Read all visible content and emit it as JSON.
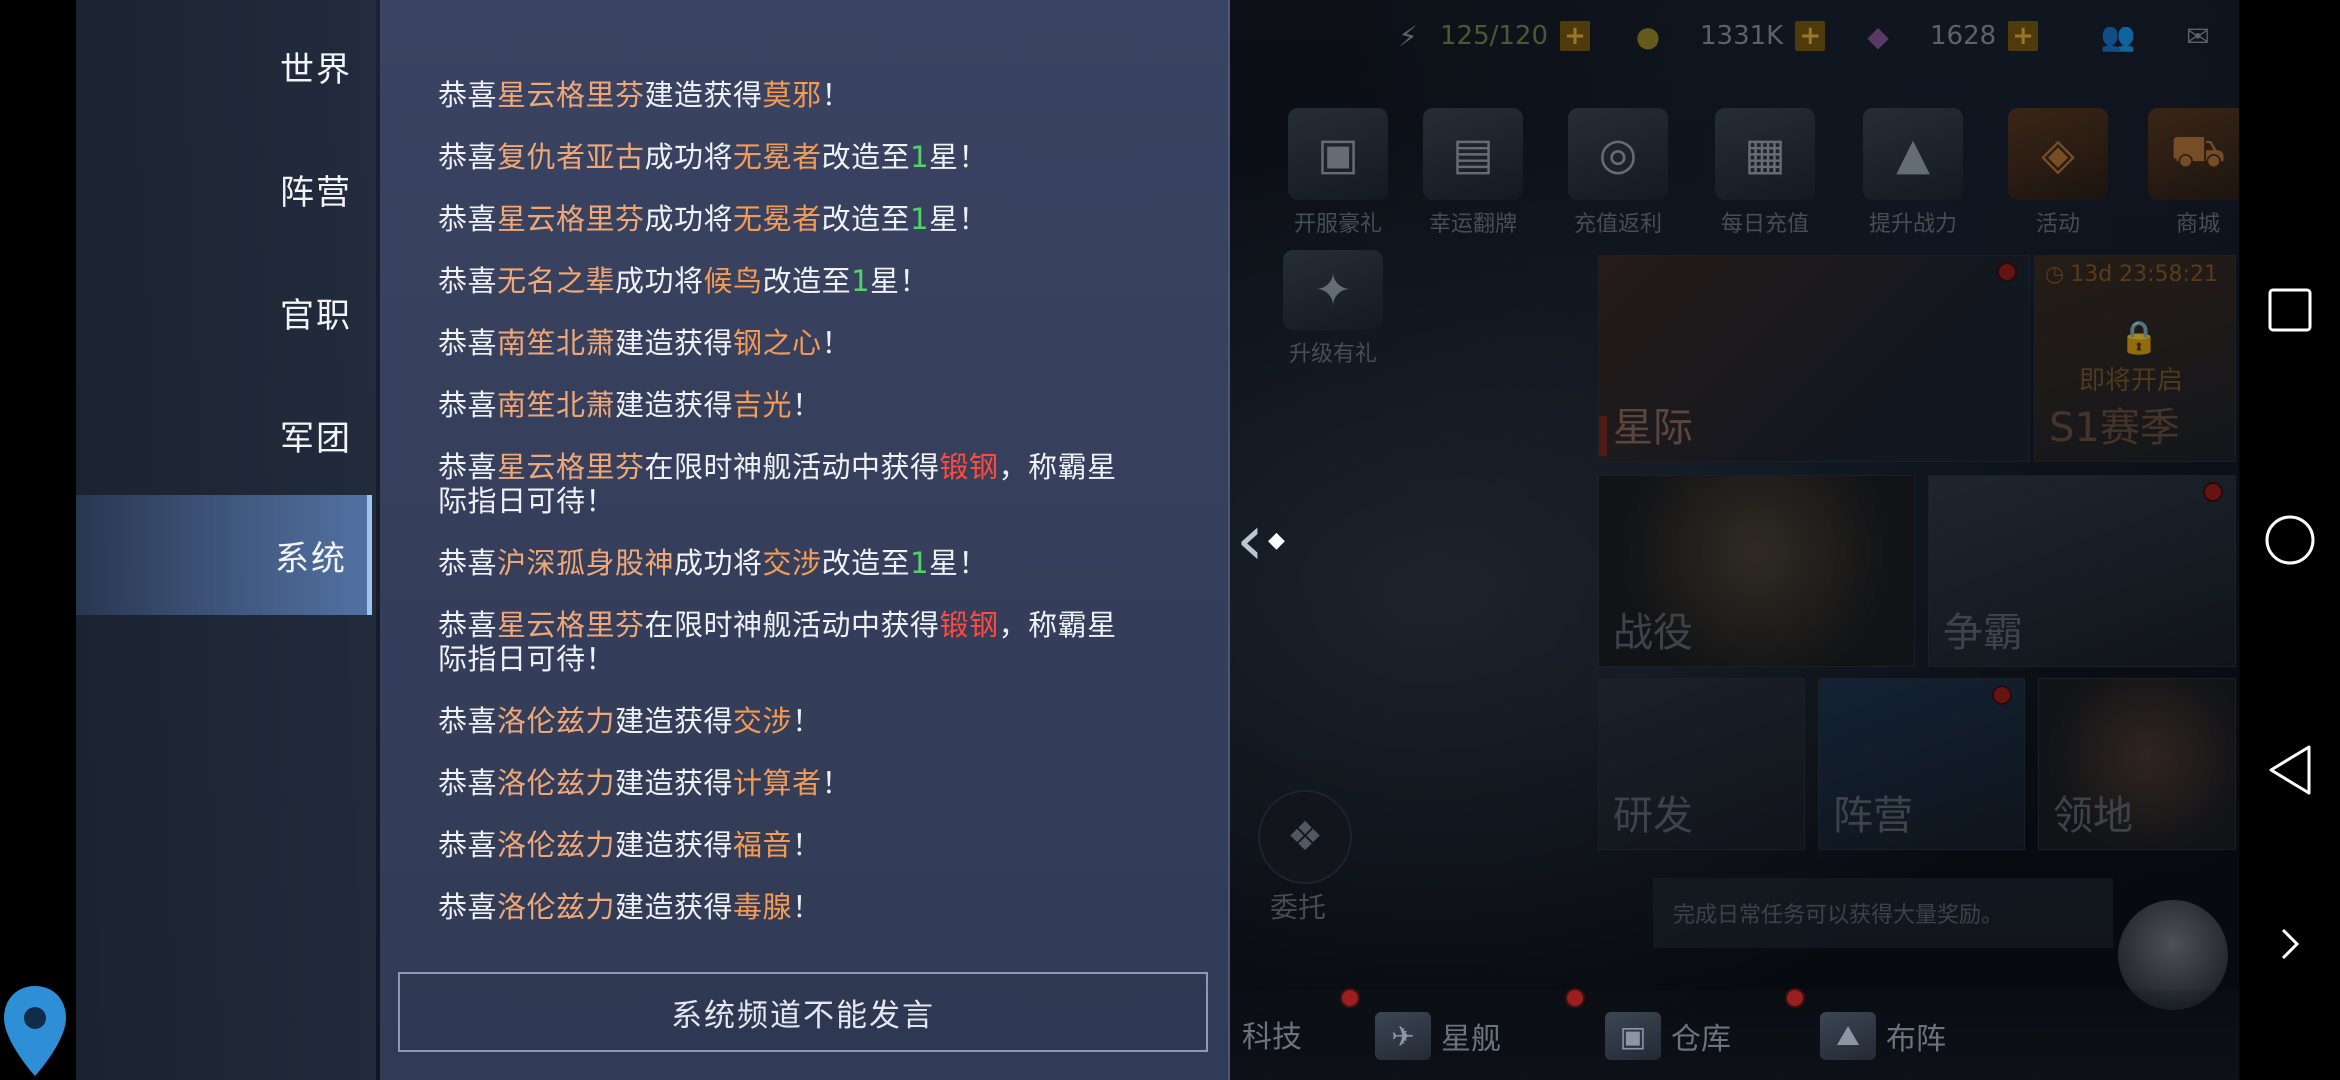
{
  "tabs": [
    {
      "label": "世界",
      "active": false
    },
    {
      "label": "阵营",
      "active": false
    },
    {
      "label": "官职",
      "active": false
    },
    {
      "label": "军团",
      "active": false
    },
    {
      "label": "系统",
      "active": true
    }
  ],
  "messages": [
    [
      {
        "t": "恭喜"
      },
      {
        "t": "星云格里芬",
        "c": "p"
      },
      {
        "t": "建造获得"
      },
      {
        "t": "莫邪",
        "c": "it"
      },
      {
        "t": "！"
      }
    ],
    [
      {
        "t": "恭喜"
      },
      {
        "t": "复仇者亚古",
        "c": "p"
      },
      {
        "t": "成功将"
      },
      {
        "t": "无冕者",
        "c": "it"
      },
      {
        "t": "改造至"
      },
      {
        "t": "1",
        "c": "g"
      },
      {
        "t": "星！"
      }
    ],
    [
      {
        "t": "恭喜"
      },
      {
        "t": "星云格里芬",
        "c": "p"
      },
      {
        "t": "成功将"
      },
      {
        "t": "无冕者",
        "c": "it"
      },
      {
        "t": "改造至"
      },
      {
        "t": "1",
        "c": "g"
      },
      {
        "t": "星！"
      }
    ],
    [
      {
        "t": "恭喜"
      },
      {
        "t": "无名之辈",
        "c": "p"
      },
      {
        "t": "成功将"
      },
      {
        "t": "候鸟",
        "c": "it"
      },
      {
        "t": "改造至"
      },
      {
        "t": "1",
        "c": "g"
      },
      {
        "t": "星！"
      }
    ],
    [
      {
        "t": "恭喜"
      },
      {
        "t": "南笙北萧",
        "c": "p"
      },
      {
        "t": "建造获得"
      },
      {
        "t": "钢之心",
        "c": "it"
      },
      {
        "t": "！"
      }
    ],
    [
      {
        "t": "恭喜"
      },
      {
        "t": "南笙北萧",
        "c": "p"
      },
      {
        "t": "建造获得"
      },
      {
        "t": "吉光",
        "c": "it"
      },
      {
        "t": "！"
      }
    ],
    [
      {
        "t": "恭喜"
      },
      {
        "t": "星云格里芬",
        "c": "p"
      },
      {
        "t": "在限时神舰活动中获得"
      },
      {
        "t": "锻钢",
        "c": "red"
      },
      {
        "t": "，称霸星际指日可待！"
      }
    ],
    [
      {
        "t": "恭喜"
      },
      {
        "t": "沪深孤身股神",
        "c": "p"
      },
      {
        "t": "成功将"
      },
      {
        "t": "交涉",
        "c": "it"
      },
      {
        "t": "改造至"
      },
      {
        "t": "1",
        "c": "g"
      },
      {
        "t": "星！"
      }
    ],
    [
      {
        "t": "恭喜"
      },
      {
        "t": "星云格里芬",
        "c": "p"
      },
      {
        "t": "在限时神舰活动中获得"
      },
      {
        "t": "锻钢",
        "c": "red"
      },
      {
        "t": "，称霸星际指日可待！"
      }
    ],
    [
      {
        "t": "恭喜"
      },
      {
        "t": "洛伦兹力",
        "c": "p"
      },
      {
        "t": "建造获得"
      },
      {
        "t": "交涉",
        "c": "it"
      },
      {
        "t": "！"
      }
    ],
    [
      {
        "t": "恭喜"
      },
      {
        "t": "洛伦兹力",
        "c": "p"
      },
      {
        "t": "建造获得"
      },
      {
        "t": "计算者",
        "c": "it"
      },
      {
        "t": "！"
      }
    ],
    [
      {
        "t": "恭喜"
      },
      {
        "t": "洛伦兹力",
        "c": "p"
      },
      {
        "t": "建造获得"
      },
      {
        "t": "福音",
        "c": "it"
      },
      {
        "t": "！"
      }
    ],
    [
      {
        "t": "恭喜"
      },
      {
        "t": "洛伦兹力",
        "c": "p"
      },
      {
        "t": "建造获得"
      },
      {
        "t": "毒腺",
        "c": "it"
      },
      {
        "t": "！"
      }
    ]
  ],
  "input": {
    "placeholder": "系统频道不能发言"
  },
  "resources": {
    "energy": "125/120",
    "gold": "1331K",
    "crystal": "1628"
  },
  "features": [
    {
      "label": "开服豪礼",
      "icon": "gift-box-icon"
    },
    {
      "label": "幸运翻牌",
      "icon": "cards-icon"
    },
    {
      "label": "充值返利",
      "icon": "rebate-icon"
    },
    {
      "label": "每日充值",
      "icon": "daily-gift-icon"
    },
    {
      "label": "提升战力",
      "icon": "power-up-icon"
    },
    {
      "label": "活动",
      "icon": "event-icon"
    },
    {
      "label": "商城",
      "icon": "cart-icon"
    }
  ],
  "upgrade_label": "升级有礼",
  "timer": "13d 23:58:21",
  "locked_label": "即将开启",
  "tiles": {
    "interstellar": "星际",
    "season": "S1赛季",
    "campaign": "战役",
    "contest": "争霸",
    "research": "研发",
    "faction": "阵营",
    "territory": "领地"
  },
  "commission": "委托",
  "daily_tip": "完成日常任务可以获得大量奖励。",
  "bottom": [
    {
      "label": "科技",
      "icon": "tech-icon"
    },
    {
      "label": "星舰",
      "icon": "ship-icon"
    },
    {
      "label": "仓库",
      "icon": "warehouse-icon"
    },
    {
      "label": "布阵",
      "icon": "formation-icon"
    }
  ],
  "colors": {
    "player": "#f0a777",
    "item": "#f39a55",
    "rare": "#ff4a3d",
    "star": "#55d16a"
  }
}
